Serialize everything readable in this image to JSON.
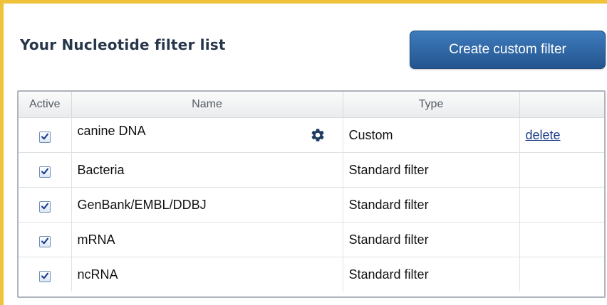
{
  "header": {
    "title": "Your Nucleotide filter list",
    "create_button_label": "Create custom filter"
  },
  "table": {
    "columns": [
      "Active",
      "Name",
      "Type",
      ""
    ],
    "rows": [
      {
        "active": true,
        "name": "canine DNA",
        "type": "Custom",
        "action": "delete",
        "settings_icon": "gear-icon"
      },
      {
        "active": true,
        "name": "Bacteria",
        "type": "Standard filter",
        "action": ""
      },
      {
        "active": true,
        "name": "GenBank/EMBL/DDBJ",
        "type": "Standard filter",
        "action": ""
      },
      {
        "active": true,
        "name": "mRNA",
        "type": "Standard filter",
        "action": ""
      },
      {
        "active": true,
        "name": "ncRNA",
        "type": "Standard filter",
        "action": ""
      }
    ]
  },
  "colors": {
    "panel_border": "#f0c23c",
    "button_bg": "#2f68a8",
    "title_text": "#27364a",
    "link_text": "#1d3d8a",
    "gear_icon": "#1f3b63"
  }
}
